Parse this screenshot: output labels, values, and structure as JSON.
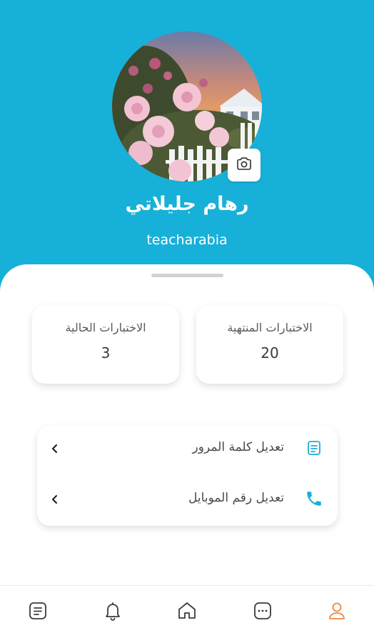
{
  "profile": {
    "name": "رهام جليلاتي",
    "username": "teacharabia"
  },
  "stats": {
    "current_label": "الاختبارات الحالية",
    "current_value": "3",
    "finished_label": "الاختبارات المنتهية",
    "finished_value": "20"
  },
  "menu": {
    "items": [
      {
        "label": "تعديل كلمة المرور",
        "icon": "document-icon"
      },
      {
        "label": "تعديل رقم الموبايل",
        "icon": "phone-icon"
      }
    ]
  },
  "bottom_nav": {
    "items": [
      {
        "icon": "document-icon"
      },
      {
        "icon": "bell-icon"
      },
      {
        "icon": "home-icon"
      },
      {
        "icon": "chat-icon"
      },
      {
        "icon": "user-icon",
        "active": true
      }
    ]
  },
  "colors": {
    "header": "#17b0d8",
    "accent": "#17b0d8",
    "active_nav": "#f0883e",
    "inactive_nav": "#3c3c3c"
  }
}
